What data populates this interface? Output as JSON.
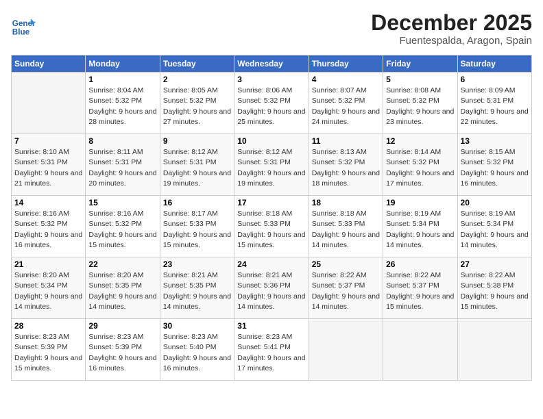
{
  "header": {
    "logo_line1": "General",
    "logo_line2": "Blue",
    "month": "December 2025",
    "location": "Fuentespalda, Aragon, Spain"
  },
  "weekdays": [
    "Sunday",
    "Monday",
    "Tuesday",
    "Wednesday",
    "Thursday",
    "Friday",
    "Saturday"
  ],
  "weeks": [
    [
      {
        "day": "",
        "empty": true
      },
      {
        "day": "1",
        "sunrise": "8:04 AM",
        "sunset": "5:32 PM",
        "daylight": "9 hours and 28 minutes."
      },
      {
        "day": "2",
        "sunrise": "8:05 AM",
        "sunset": "5:32 PM",
        "daylight": "9 hours and 27 minutes."
      },
      {
        "day": "3",
        "sunrise": "8:06 AM",
        "sunset": "5:32 PM",
        "daylight": "9 hours and 25 minutes."
      },
      {
        "day": "4",
        "sunrise": "8:07 AM",
        "sunset": "5:32 PM",
        "daylight": "9 hours and 24 minutes."
      },
      {
        "day": "5",
        "sunrise": "8:08 AM",
        "sunset": "5:32 PM",
        "daylight": "9 hours and 23 minutes."
      },
      {
        "day": "6",
        "sunrise": "8:09 AM",
        "sunset": "5:31 PM",
        "daylight": "9 hours and 22 minutes."
      }
    ],
    [
      {
        "day": "7",
        "sunrise": "8:10 AM",
        "sunset": "5:31 PM",
        "daylight": "9 hours and 21 minutes."
      },
      {
        "day": "8",
        "sunrise": "8:11 AM",
        "sunset": "5:31 PM",
        "daylight": "9 hours and 20 minutes."
      },
      {
        "day": "9",
        "sunrise": "8:12 AM",
        "sunset": "5:31 PM",
        "daylight": "9 hours and 19 minutes."
      },
      {
        "day": "10",
        "sunrise": "8:12 AM",
        "sunset": "5:31 PM",
        "daylight": "9 hours and 19 minutes."
      },
      {
        "day": "11",
        "sunrise": "8:13 AM",
        "sunset": "5:32 PM",
        "daylight": "9 hours and 18 minutes."
      },
      {
        "day": "12",
        "sunrise": "8:14 AM",
        "sunset": "5:32 PM",
        "daylight": "9 hours and 17 minutes."
      },
      {
        "day": "13",
        "sunrise": "8:15 AM",
        "sunset": "5:32 PM",
        "daylight": "9 hours and 16 minutes."
      }
    ],
    [
      {
        "day": "14",
        "sunrise": "8:16 AM",
        "sunset": "5:32 PM",
        "daylight": "9 hours and 16 minutes."
      },
      {
        "day": "15",
        "sunrise": "8:16 AM",
        "sunset": "5:32 PM",
        "daylight": "9 hours and 15 minutes."
      },
      {
        "day": "16",
        "sunrise": "8:17 AM",
        "sunset": "5:33 PM",
        "daylight": "9 hours and 15 minutes."
      },
      {
        "day": "17",
        "sunrise": "8:18 AM",
        "sunset": "5:33 PM",
        "daylight": "9 hours and 15 minutes."
      },
      {
        "day": "18",
        "sunrise": "8:18 AM",
        "sunset": "5:33 PM",
        "daylight": "9 hours and 14 minutes."
      },
      {
        "day": "19",
        "sunrise": "8:19 AM",
        "sunset": "5:34 PM",
        "daylight": "9 hours and 14 minutes."
      },
      {
        "day": "20",
        "sunrise": "8:19 AM",
        "sunset": "5:34 PM",
        "daylight": "9 hours and 14 minutes."
      }
    ],
    [
      {
        "day": "21",
        "sunrise": "8:20 AM",
        "sunset": "5:34 PM",
        "daylight": "9 hours and 14 minutes."
      },
      {
        "day": "22",
        "sunrise": "8:20 AM",
        "sunset": "5:35 PM",
        "daylight": "9 hours and 14 minutes."
      },
      {
        "day": "23",
        "sunrise": "8:21 AM",
        "sunset": "5:35 PM",
        "daylight": "9 hours and 14 minutes."
      },
      {
        "day": "24",
        "sunrise": "8:21 AM",
        "sunset": "5:36 PM",
        "daylight": "9 hours and 14 minutes."
      },
      {
        "day": "25",
        "sunrise": "8:22 AM",
        "sunset": "5:37 PM",
        "daylight": "9 hours and 14 minutes."
      },
      {
        "day": "26",
        "sunrise": "8:22 AM",
        "sunset": "5:37 PM",
        "daylight": "9 hours and 15 minutes."
      },
      {
        "day": "27",
        "sunrise": "8:22 AM",
        "sunset": "5:38 PM",
        "daylight": "9 hours and 15 minutes."
      }
    ],
    [
      {
        "day": "28",
        "sunrise": "8:23 AM",
        "sunset": "5:39 PM",
        "daylight": "9 hours and 15 minutes."
      },
      {
        "day": "29",
        "sunrise": "8:23 AM",
        "sunset": "5:39 PM",
        "daylight": "9 hours and 16 minutes."
      },
      {
        "day": "30",
        "sunrise": "8:23 AM",
        "sunset": "5:40 PM",
        "daylight": "9 hours and 16 minutes."
      },
      {
        "day": "31",
        "sunrise": "8:23 AM",
        "sunset": "5:41 PM",
        "daylight": "9 hours and 17 minutes."
      },
      {
        "day": "",
        "empty": true
      },
      {
        "day": "",
        "empty": true
      },
      {
        "day": "",
        "empty": true
      }
    ]
  ]
}
